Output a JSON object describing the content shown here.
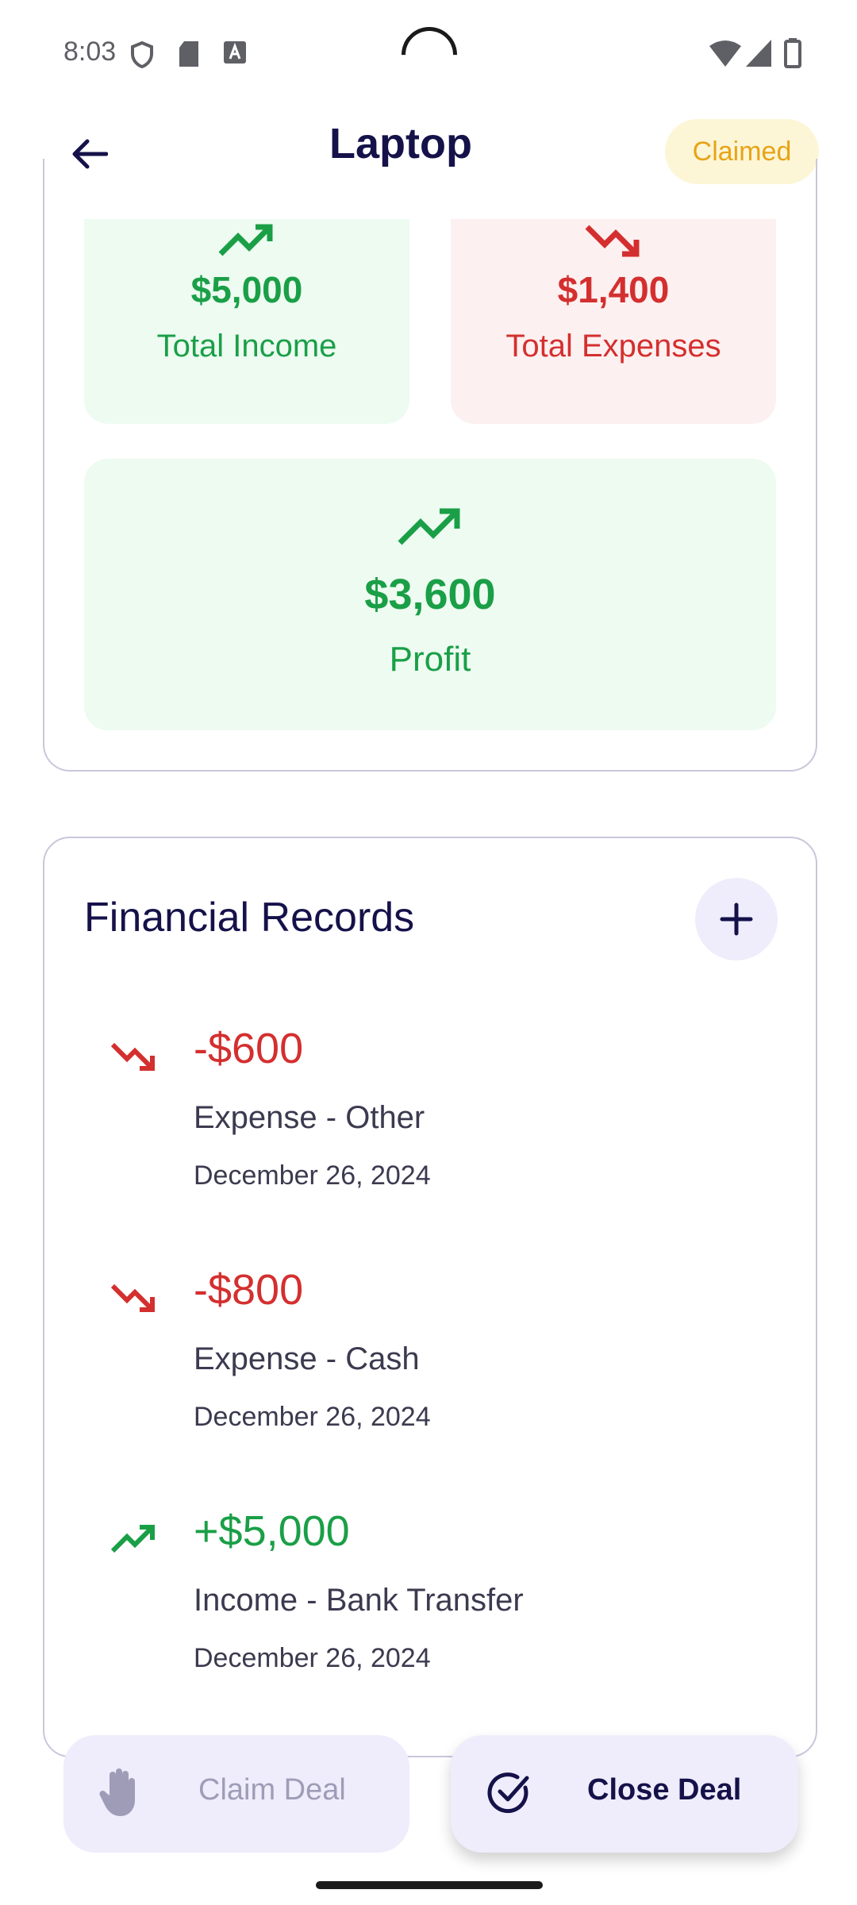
{
  "status_bar": {
    "time": "8:03"
  },
  "header": {
    "title": "Laptop",
    "status_badge": "Claimed"
  },
  "summary": {
    "income": {
      "value": "$5,000",
      "label": "Total Income"
    },
    "expenses": {
      "value": "$1,400",
      "label": "Total Expenses"
    },
    "profit": {
      "value": "$3,600",
      "label": "Profit"
    }
  },
  "records": {
    "title": "Financial Records",
    "items": [
      {
        "amount": "-$600",
        "description": "Expense - Other",
        "date": "December 26, 2024",
        "kind": "expense"
      },
      {
        "amount": "-$800",
        "description": "Expense - Cash",
        "date": "December 26, 2024",
        "kind": "expense"
      },
      {
        "amount": "+$5,000",
        "description": "Income - Bank Transfer",
        "date": "December 26, 2024",
        "kind": "income"
      }
    ]
  },
  "actions": {
    "claim_label": "Claim Deal",
    "close_label": "Close Deal"
  },
  "colors": {
    "income": "#1a9f47",
    "expense": "#d42f2f",
    "accent": "#15124a",
    "badge": "#e8a317"
  }
}
